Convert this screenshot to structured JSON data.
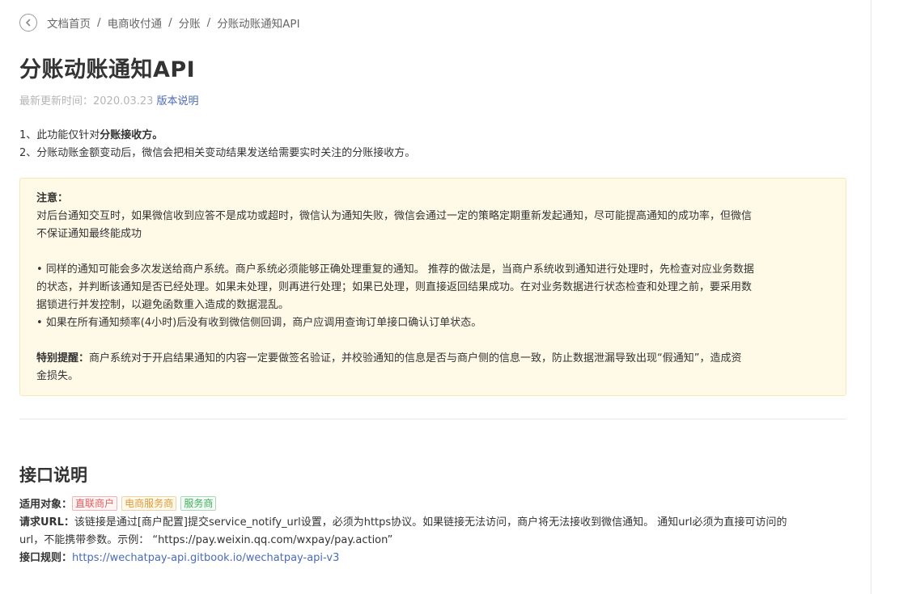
{
  "breadcrumb": [
    "文档首页",
    "电商收付通",
    "分账",
    "分账动账通知API"
  ],
  "title": "分账动账通知API",
  "meta": {
    "updated": "最新更新时间：2020.03.23",
    "version_link": "版本说明"
  },
  "intro": {
    "line1_prefix": "1、此功能仅针对",
    "line1_bold": "分账接收方。",
    "line2": "2、分账动账金额变动后，微信会把相关变动结果发送给需要实时关注的分账接收方。"
  },
  "notice": {
    "heading": "注意：",
    "p1a": "对后台通知交互时，如果微信收到应答不是成功或超时，微信认为通知失败，微信会通过一定的策略定期重新发起通知，尽可能提高通知的成功率，但微信",
    "p1b": "不保证通知最终能成功",
    "p2a": "• 同样的通知可能会多次发送给商户系统。商户系统必须能够正确处理重复的通知。 推荐的做法是，当商户系统收到通知进行处理时，先检查对应业务数据",
    "p2b": "的状态，并判断该通知是否已经处理。如果未处理，则再进行处理；如果已处理，则直接返回结果成功。在对业务数据进行状态检查和处理之前，要采用数",
    "p2c": "据锁进行并发控制，以避免函数重入造成的数据混乱。",
    "p3": "• 如果在所有通知频率(4小时)后没有收到微信侧回调，商户应调用查询订单接口确认订单状态。",
    "special_label": "特别提醒：",
    "special_a": "商户系统对于开启结果通知的内容一定要做签名验证，并校验通知的信息是否与商户侧的信息一致，防止数据泄漏导致出现“假通知”，造成资",
    "special_b": "金损失。"
  },
  "section": {
    "title": "接口说明",
    "applicable_label": "适用对象：",
    "tags": [
      "直联商户",
      "电商服务商",
      "服务商"
    ],
    "url_label": "请求URL：",
    "url_text_a": "该链接是通过[商户配置]提交service_notify_url设置，必须为https协议。如果链接无法访问，商户将无法接收到微信通知。 通知url必须为直接可访问的",
    "url_text_b": "url，不能携带参数。示例： “https://pay.weixin.qq.com/wxpay/pay.action”",
    "rules_label": "接口规则：",
    "rules_link": "https://wechatpay-api.gitbook.io/wechatpay-api-v3"
  },
  "icons": {
    "back": "chevron-left-circle-icon"
  }
}
